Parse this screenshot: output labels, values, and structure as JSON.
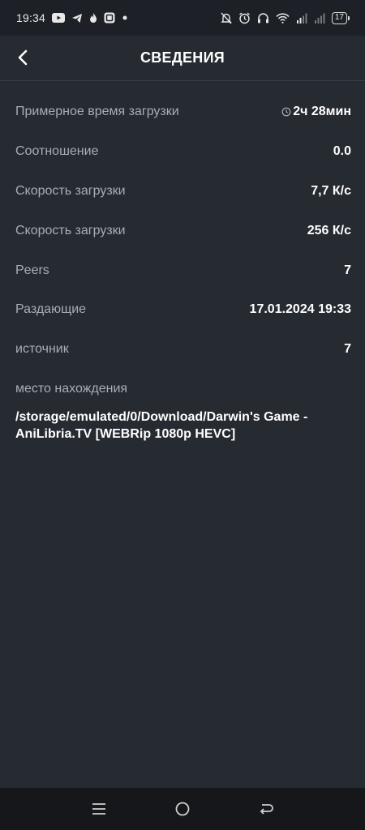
{
  "status_bar": {
    "time": "19:34",
    "battery": "17",
    "left_icons": [
      "youtube-icon",
      "telegram-icon",
      "flame-icon",
      "app-icon",
      "dot-icon"
    ],
    "right_icons": [
      "notifications-off-icon",
      "alarm-icon",
      "headphones-icon",
      "wifi-icon",
      "signal-icon",
      "signal-icon",
      "battery-icon"
    ]
  },
  "header": {
    "title": "СВЕДЕНИЯ",
    "back_icon": "chevron-left-icon"
  },
  "details": [
    {
      "label": "Примерное время загрузки",
      "value": "2ч 28мин",
      "icon": "clock-icon"
    },
    {
      "label": "Соотношение",
      "value": "0.0"
    },
    {
      "label": "Скорость загрузки",
      "value": "7,7 К/с"
    },
    {
      "label": "Скорость загрузки",
      "value": "256 К/с"
    },
    {
      "label": "Peers",
      "value": "7"
    },
    {
      "label": "Раздающие",
      "value": "17.01.2024 19:33"
    },
    {
      "label": "источник",
      "value": "7"
    }
  ],
  "location": {
    "label": "место нахождения",
    "path": "/storage/emulated/0/Download/Darwin's Game - AniLibria.TV [WEBRip 1080p HEVC]"
  },
  "colors": {
    "background": "#262a31",
    "statusbar": "#1d2026",
    "navbar": "#15171b",
    "label": "#a9adb5",
    "value": "#ffffff"
  },
  "navbar": [
    "menu-icon",
    "home-icon",
    "back-icon"
  ]
}
